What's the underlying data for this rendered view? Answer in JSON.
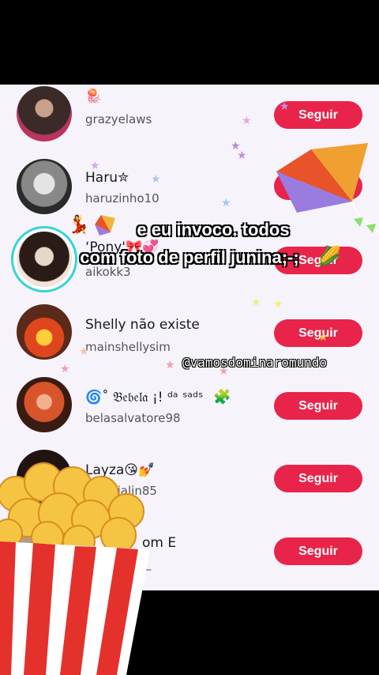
{
  "follow_label": "Seguir",
  "users": [
    {
      "name": "🪼",
      "handle": "grazyelaws"
    },
    {
      "name": "Haru✮",
      "handle": "haruzinho10"
    },
    {
      "name": "‘Pony'🎀💞",
      "handle": "aikokk3"
    },
    {
      "name": "Shelly não existe",
      "handle": "mainshellysim"
    },
    {
      "name": "🌀˚ 𝔅𝔢𝔟𝔢𝔩𝔞 ¡! ᵈᵃ ˢᵃᵈˢ",
      "handle": "belasalvatore98"
    },
    {
      "name": "Layza😘💅",
      "handle": "claudialin85"
    },
    {
      "name": "om E",
      "handle": "k_"
    }
  ],
  "caption": {
    "line1": "e eu invoco. todos",
    "line2": "com foto de perfil junina;-;"
  },
  "watermark": "@vamosdominaromundo",
  "colors": {
    "follow": "#e8244b",
    "panel": "#f6f3fb",
    "ring": "#35d4d6"
  },
  "icons": [
    "kite-icon",
    "popcorn-icon",
    "corn-icon",
    "puzzle-icon",
    "star-icon"
  ]
}
